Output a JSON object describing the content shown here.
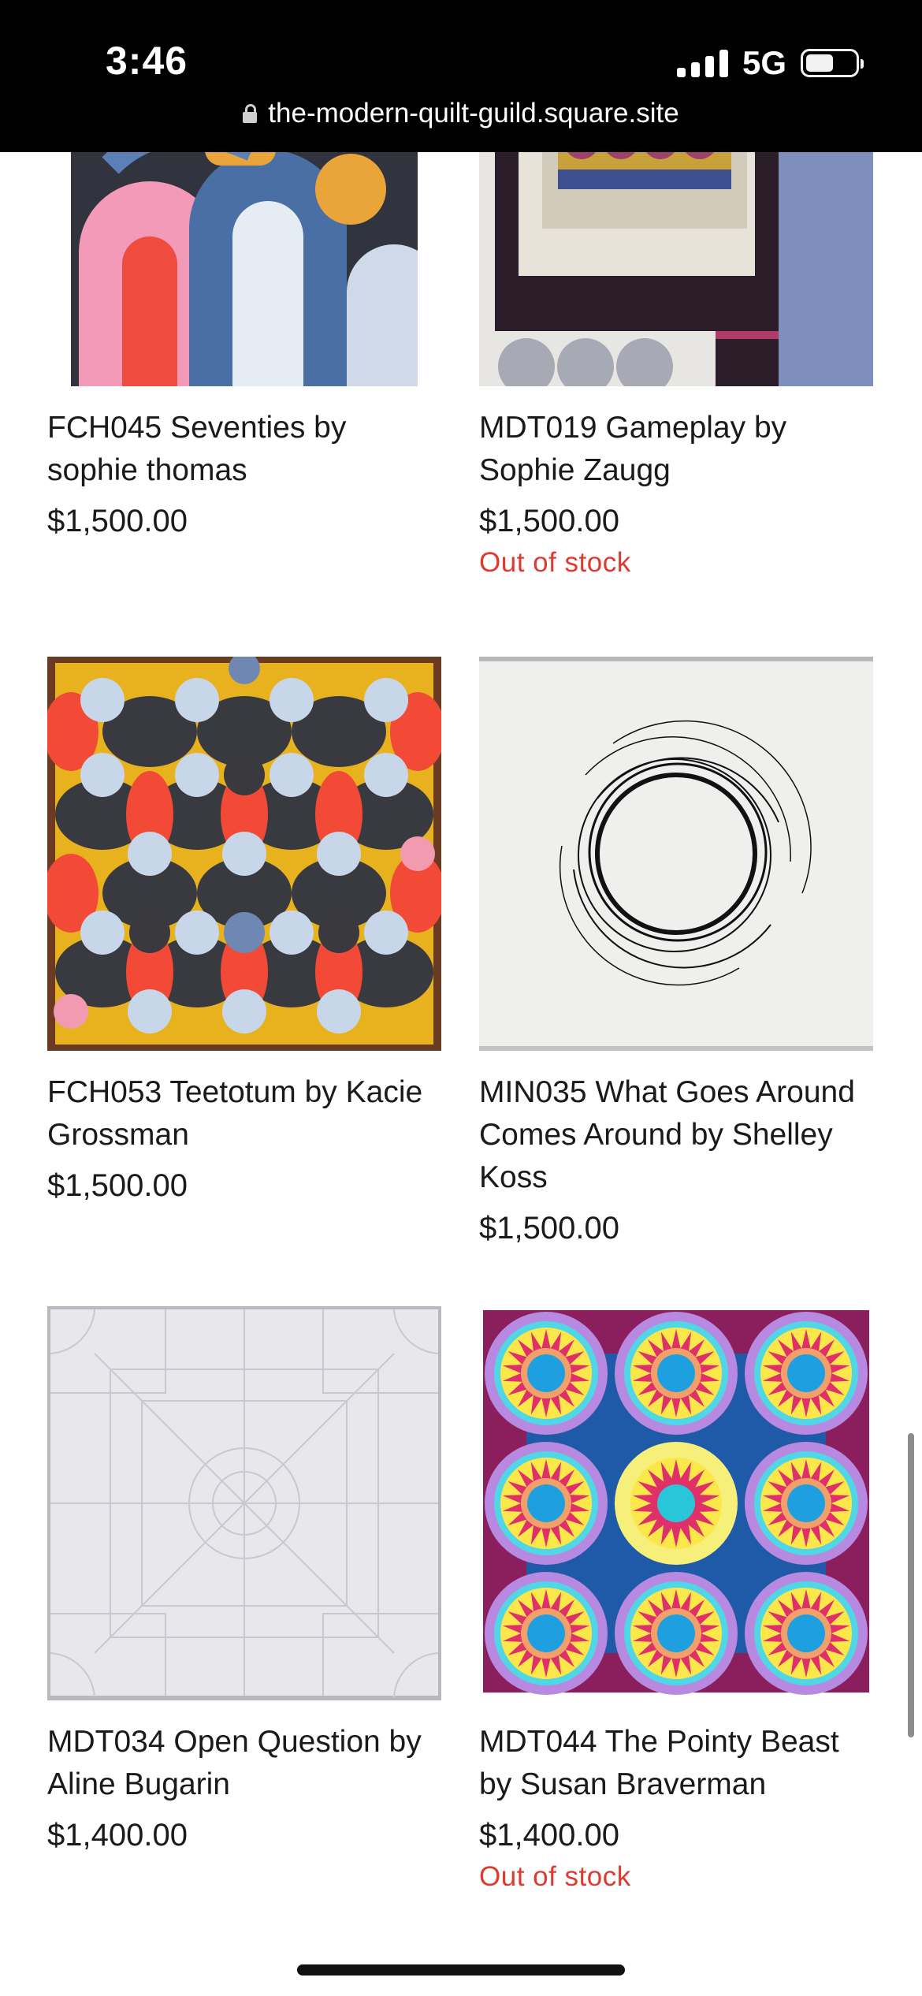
{
  "status_bar": {
    "time": "3:46",
    "network": "5G",
    "signal_bars": 4,
    "battery_level": 0.55
  },
  "browser": {
    "url": "the-modern-quilt-guild.square.site"
  },
  "products": [
    {
      "title": "FCH045 Seventies by sophie thomas",
      "price": "$1,500.00",
      "stock": "",
      "image_icon": "quilt-seventies-image"
    },
    {
      "title": "MDT019 Gameplay by Sophie Zaugg",
      "price": "$1,500.00",
      "stock": "Out of stock",
      "image_icon": "quilt-gameplay-image"
    },
    {
      "title": "FCH053 Teetotum by Kacie Grossman",
      "price": "$1,500.00",
      "stock": "",
      "image_icon": "quilt-teetotum-image"
    },
    {
      "title": "MIN035 What Goes Around Comes Around by Shelley Koss",
      "price": "$1,500.00",
      "stock": "",
      "image_icon": "quilt-what-goes-around-image"
    },
    {
      "title": "MDT034 Open Question by Aline Bugarin",
      "price": "$1,400.00",
      "stock": "",
      "image_icon": "quilt-open-question-image"
    },
    {
      "title": "MDT044 The Pointy Beast by Susan Braverman",
      "price": "$1,400.00",
      "stock": "Out of stock",
      "image_icon": "quilt-pointy-beast-image"
    }
  ],
  "colors": {
    "out_of_stock": "#e03a2f",
    "status_bar_bg": "#000000"
  }
}
